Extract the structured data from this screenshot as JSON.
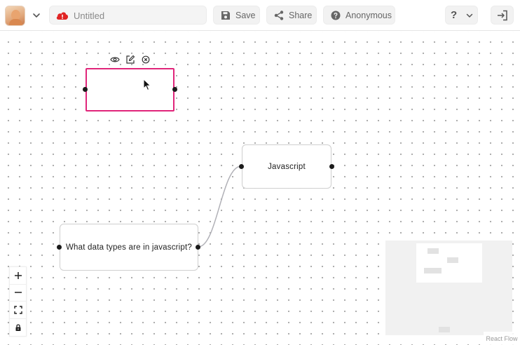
{
  "header": {
    "title_placeholder": "Untitled",
    "save_label": "Save",
    "share_label": "Share",
    "user_label": "Anonymous",
    "help_label": "?"
  },
  "flow": {
    "nodes": [
      {
        "id": "empty",
        "label": ""
      },
      {
        "id": "javascript",
        "label": "Javascript"
      },
      {
        "id": "question",
        "label": "What data types are in javascript?"
      }
    ],
    "edges": [
      {
        "source": "question",
        "target": "javascript"
      }
    ],
    "selected_node": "empty"
  },
  "attribution": "React Flow",
  "colors": {
    "selection": "#e0257a",
    "unsaved_badge": "#e02424",
    "edge": "#b1b1b7"
  },
  "icons": {
    "toolbar": [
      "eye-icon",
      "edit-icon",
      "close-circle-icon"
    ],
    "controls": [
      "plus-icon",
      "minus-icon",
      "fit-view-icon",
      "lock-icon"
    ]
  }
}
